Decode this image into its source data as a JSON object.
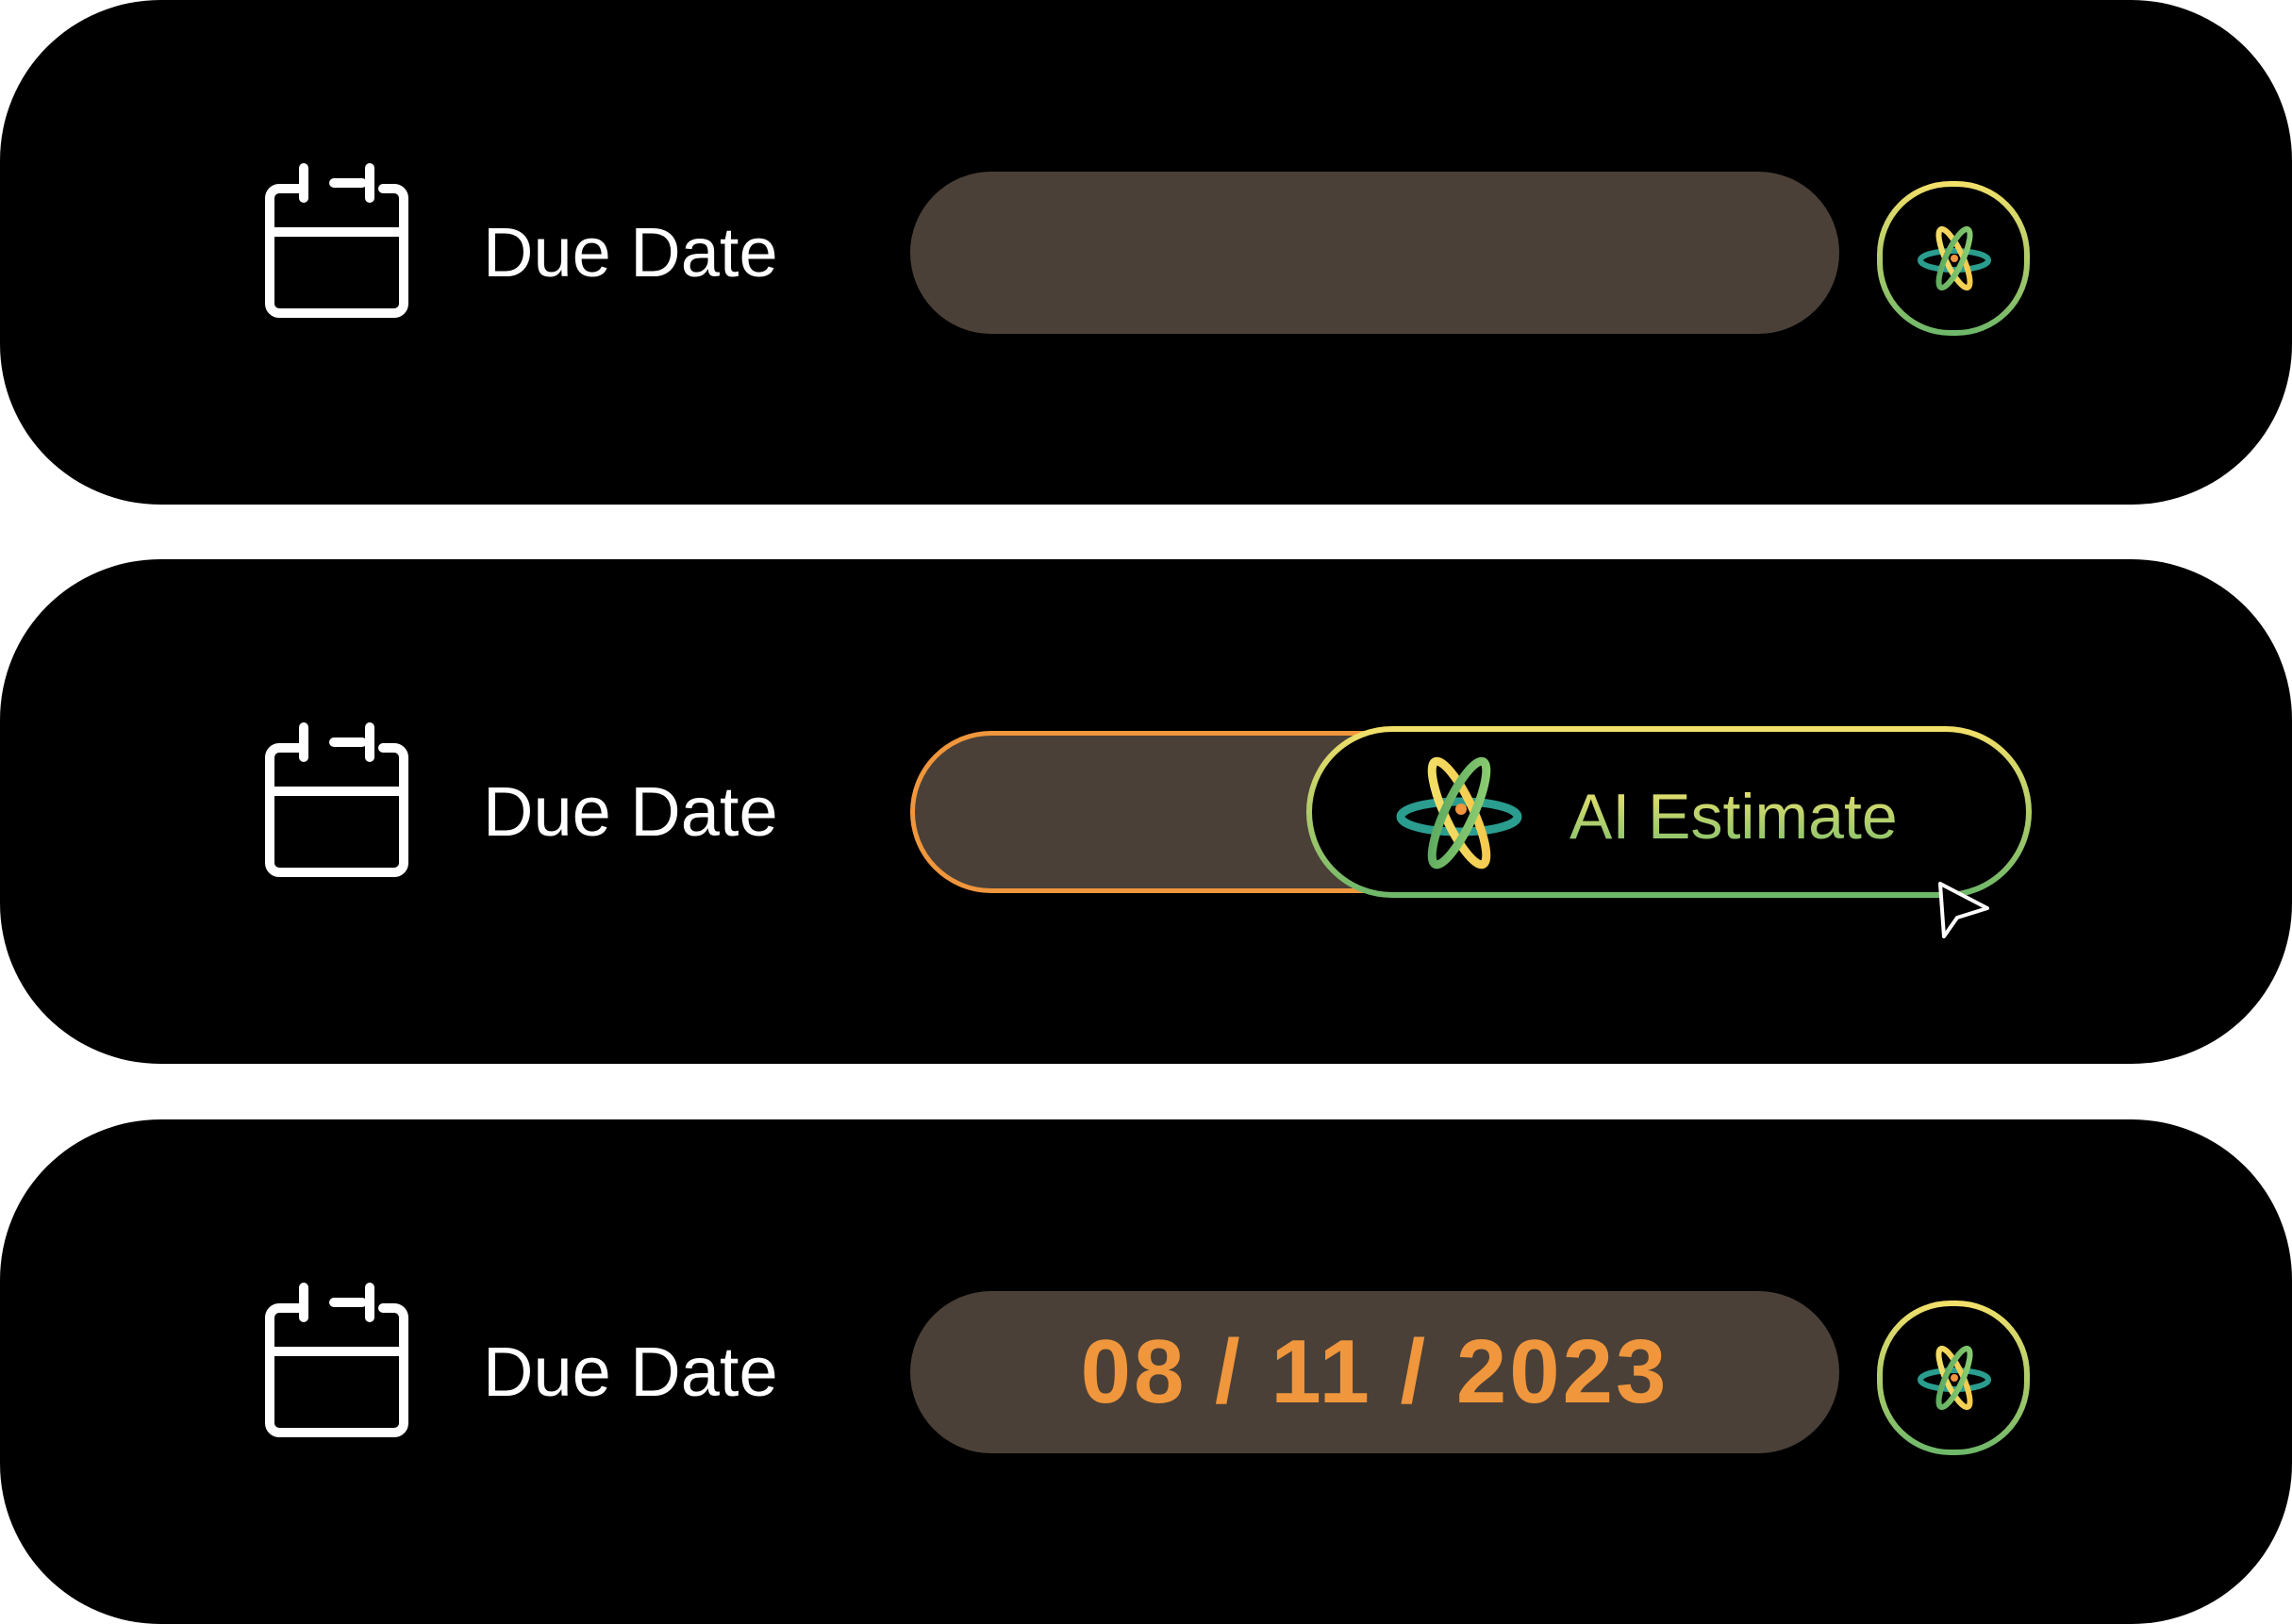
{
  "rows": [
    {
      "label": "Due Date",
      "value": "",
      "state": "empty",
      "ai_button": {
        "icon": "atom-ai-icon"
      }
    },
    {
      "label": "Due Date",
      "value": "",
      "state": "hover",
      "ai_button": {
        "icon": "atom-ai-icon",
        "label": "AI Estimate"
      }
    },
    {
      "label": "Due Date",
      "value": "08 / 11 / 2023",
      "state": "filled",
      "ai_button": {
        "icon": "atom-ai-icon"
      }
    }
  ],
  "icons": {
    "calendar": "calendar-icon",
    "ai": "atom-ai-icon",
    "cursor": "mouse-cursor-icon"
  },
  "colors": {
    "card_bg": "#000000",
    "field_bg": "#4a4037",
    "accent_orange": "#f0963c",
    "gradient_yellow": "#f2e06a",
    "gradient_green": "#6fb86a",
    "teal": "#2a9d8f"
  }
}
